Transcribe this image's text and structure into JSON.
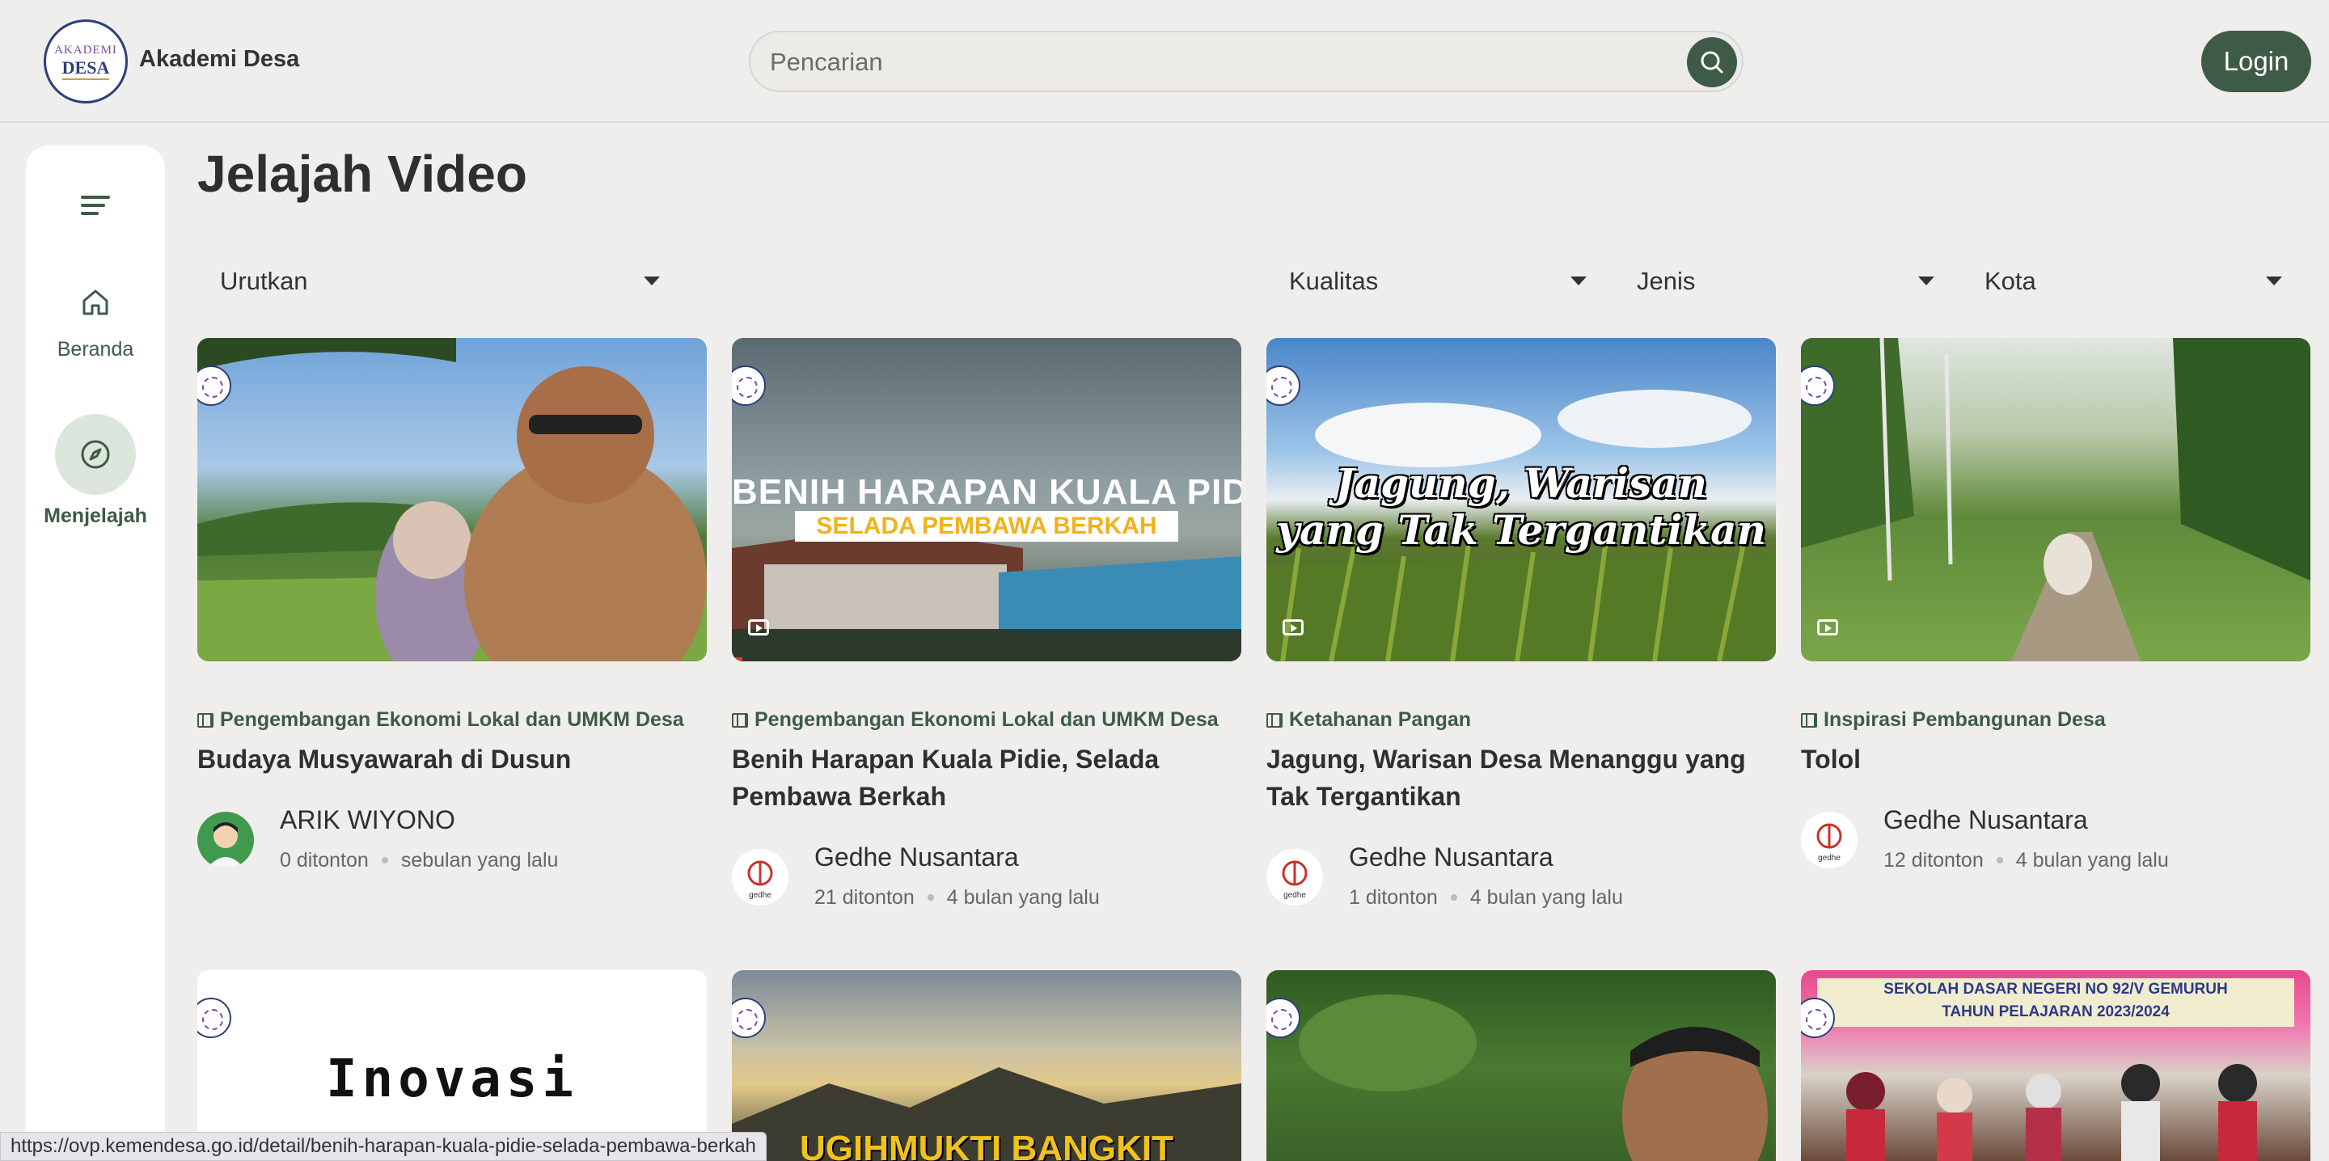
{
  "header": {
    "brand_name": "Akademi Desa",
    "logo_text_top": "AKADEMI",
    "logo_text_main": "DESA",
    "search_placeholder": "Pencarian",
    "login_label": "Login"
  },
  "sidebar": {
    "items": [
      {
        "label": "Beranda",
        "icon": "home-icon",
        "active": false
      },
      {
        "label": "Menjelajah",
        "icon": "compass-icon",
        "active": true
      }
    ]
  },
  "main": {
    "title": "Jelajah Video",
    "filters": {
      "sort": "Urutkan",
      "quality": "Kualitas",
      "type": "Jenis",
      "city": "Kota"
    },
    "videos": [
      {
        "category": "Pengembangan Ekonomi Lokal dan UMKM Desa",
        "title": "Budaya Musyawarah di Dusun",
        "author": "ARIK WIYONO",
        "views": "0 ditonton",
        "time": "sebulan yang lalu",
        "thumb_text": ""
      },
      {
        "category": "Pengembangan Ekonomi Lokal dan UMKM Desa",
        "title": "Benih Harapan Kuala Pidie, Selada Pembawa Berkah",
        "author": "Gedhe Nusantara",
        "views": "21 ditonton",
        "time": "4 bulan yang lalu",
        "thumb_text": "BENIH HARAPAN KUALA PIDIE",
        "thumb_subtext": "SELADA PEMBAWA BERKAH",
        "progress": 0.02
      },
      {
        "category": "Ketahanan Pangan",
        "title": "Jagung, Warisan Desa Menanggu yang Tak Tergantikan",
        "author": "Gedhe Nusantara",
        "views": "1 ditonton",
        "time": "4 bulan yang lalu",
        "thumb_text": "Jagung, Warisan",
        "thumb_subtext": "yang Tak Tergantikan"
      },
      {
        "category": "Inspirasi Pembangunan Desa",
        "title": "Tolol",
        "author": "Gedhe Nusantara",
        "views": "12 ditonton",
        "time": "4 bulan yang lalu",
        "thumb_text": ""
      }
    ],
    "row2_thumbs": [
      {
        "thumb_text": "Inovasi"
      },
      {
        "thumb_text": "UGIHMUKTI BANGKIT"
      },
      {
        "thumb_text": ""
      },
      {
        "thumb_text": "SEKOLAH DASAR NEGERI NO 92/V GEMURUH",
        "thumb_subtext": "TAHUN PELAJARAN 2023/2024"
      }
    ]
  },
  "status_url": "https://ovp.kemendesa.go.id/detail/benih-harapan-kuala-pidie-selada-pembawa-berkah",
  "author_avatar_label": "gedhe",
  "colors": {
    "accent": "#3e5b47",
    "background": "#efeeec"
  }
}
